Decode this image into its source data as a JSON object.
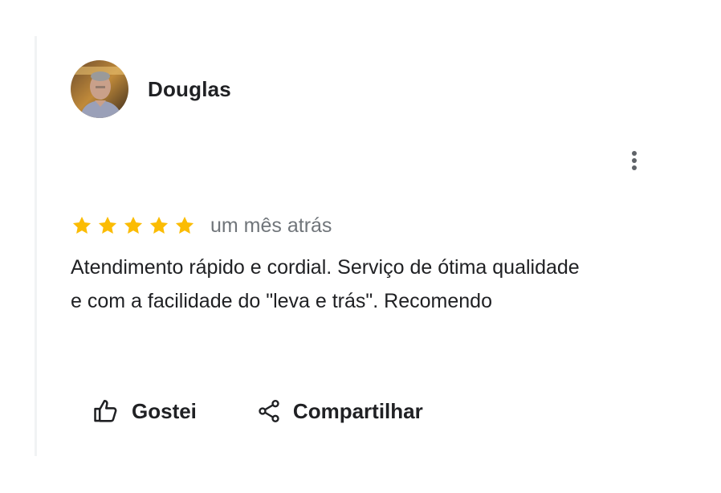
{
  "review": {
    "author": "Douglas",
    "date": "um mês atrás",
    "rating": 5,
    "max_rating": 5,
    "text": "Atendimento rápido e cordial. Serviço de ótima qualidade e com a facilidade do \"leva e trás\". Recomendo"
  },
  "actions": {
    "like_label": "Gostei",
    "share_label": "Compartilhar"
  },
  "icons": {
    "star": "star-icon",
    "more": "more-vert-icon",
    "like": "thumb-up-icon",
    "share": "share-icon"
  },
  "colors": {
    "star": "#fbbc04",
    "text": "#202124",
    "muted": "#70757a"
  }
}
